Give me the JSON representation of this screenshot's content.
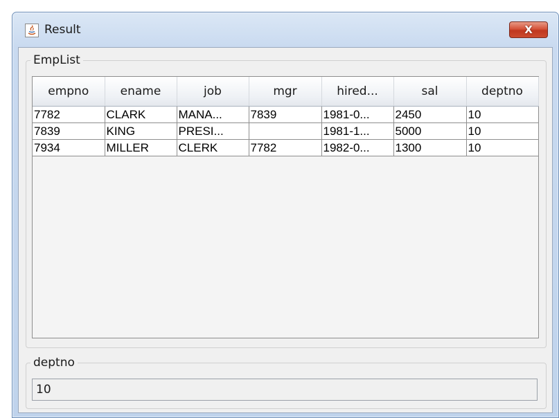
{
  "window": {
    "title": "Result",
    "close_label": "X"
  },
  "emplist": {
    "legend": "EmpList",
    "columns": [
      "empno",
      "ename",
      "job",
      "mgr",
      "hired...",
      "sal",
      "deptno"
    ],
    "rows": [
      [
        "7782",
        "CLARK",
        "MANA...",
        "7839",
        "1981-0...",
        "2450",
        "10"
      ],
      [
        "7839",
        "KING",
        "PRESI...",
        "",
        "1981-1...",
        "5000",
        "10"
      ],
      [
        "7934",
        "MILLER",
        "CLERK",
        "7782",
        "1982-0...",
        "1300",
        "10"
      ]
    ]
  },
  "deptno": {
    "legend": "deptno",
    "value": "10"
  }
}
